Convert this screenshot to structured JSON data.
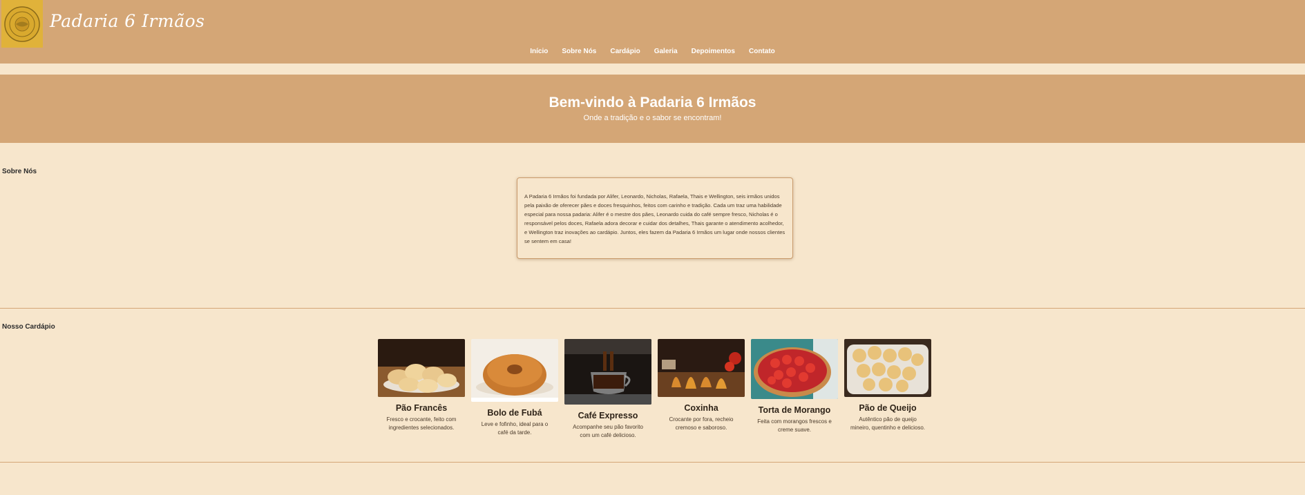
{
  "header": {
    "brand": "Padaria 6 Irmãos",
    "nav": [
      "Início",
      "Sobre Nós",
      "Cardápio",
      "Galeria",
      "Depoimentos",
      "Contato"
    ]
  },
  "hero": {
    "title": "Bem-vindo à Padaria 6 Irmãos",
    "subtitle": "Onde a tradição e o sabor se encontram!"
  },
  "about": {
    "title": "Sobre Nós",
    "text": "A Padaria 6 Irmãos foi fundada por Alifer, Leonardo, Nicholas, Rafaela, Thais e Wellington, seis irmãos unidos pela paixão de oferecer pães e doces fresquinhos, feitos com carinho e tradição. Cada um traz uma habilidade especial para nossa padaria: Alifer é o mestre dos pães, Leonardo cuida do café sempre fresco, Nicholas é o responsável pelos doces, Rafaela adora decorar e cuidar dos detalhes, Thais garante o atendimento acolhedor, e Wellington traz inovações ao cardápio. Juntos, eles fazem da Padaria 6 Irmãos um lugar onde nossos clientes se sentem em casa!"
  },
  "menu": {
    "title": "Nosso Cardápio",
    "items": [
      {
        "name": "Pão Francês",
        "desc": "Fresco e crocante, feito com ingredientes selecionados."
      },
      {
        "name": "Bolo de Fubá",
        "desc": "Leve e fofinho, ideal para o café da tarde."
      },
      {
        "name": "Café Expresso",
        "desc": "Acompanhe seu pão favorito com um café delicioso."
      },
      {
        "name": "Coxinha",
        "desc": "Crocante por fora, recheio cremoso e saboroso."
      },
      {
        "name": "Torta de Morango",
        "desc": "Feita com morangos frescos e creme suave."
      },
      {
        "name": "Pão de Queijo",
        "desc": "Autêntico pão de queijo mineiro, quentinho e delicioso."
      }
    ]
  },
  "colors": {
    "header": "#d4a676",
    "background": "#f7e6cc",
    "logo": "#e0b23a"
  }
}
